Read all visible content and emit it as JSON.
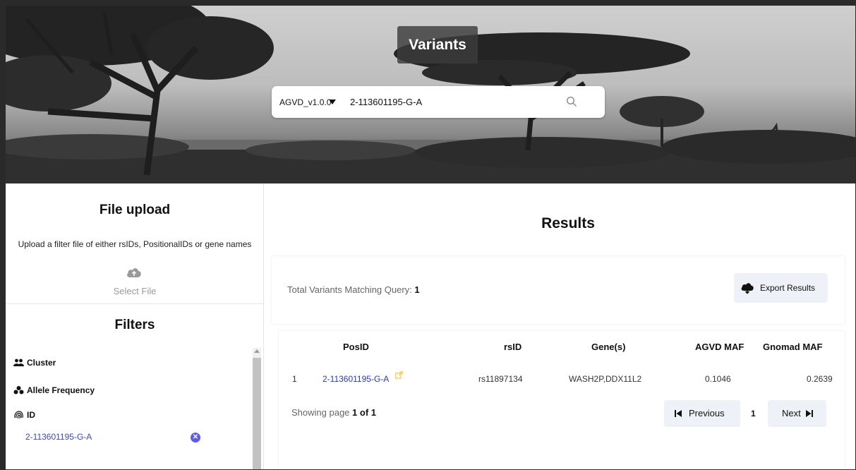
{
  "hero": {
    "title": "Variants",
    "search": {
      "dataset_version": "AGVD_v1.0.0",
      "query": "2-113601195-G-A"
    }
  },
  "file_upload": {
    "title": "File upload",
    "description": "Upload a filter file of either rsIDs, PositionalIDs or gene names",
    "select_label": "Select File"
  },
  "filters": {
    "title": "Filters",
    "items": [
      {
        "label": "Cluster",
        "icon": "users-icon"
      },
      {
        "label": "Allele Frequency",
        "icon": "cluster-icon"
      },
      {
        "label": "ID",
        "icon": "fingerprint-icon"
      }
    ],
    "id_values": [
      "2-113601195-G-A"
    ]
  },
  "results": {
    "title": "Results",
    "total_label": "Total Variants Matching Query:",
    "total_value": "1",
    "export_label": "Export Results",
    "columns": [
      "PosID",
      "rsID",
      "Gene(s)",
      "AGVD MAF",
      "Gnomad MAF"
    ],
    "rows": [
      {
        "index": "1",
        "posid": "2-113601195-G-A",
        "rsid": "rs11897134",
        "genes": "WASH2P,DDX11L2",
        "agvd_maf": "0.1046",
        "gnomad_maf": "0.2639"
      }
    ],
    "paging_prefix": "Showing page",
    "paging_value": "1 of 1",
    "previous_label": "Previous",
    "current_page": "1",
    "next_label": "Next"
  },
  "colors": {
    "link": "#2b36d9",
    "remove_badge": "#5b5bf2",
    "button_bg": "#eef1f7",
    "external_link_icon": "#f3c84a"
  }
}
